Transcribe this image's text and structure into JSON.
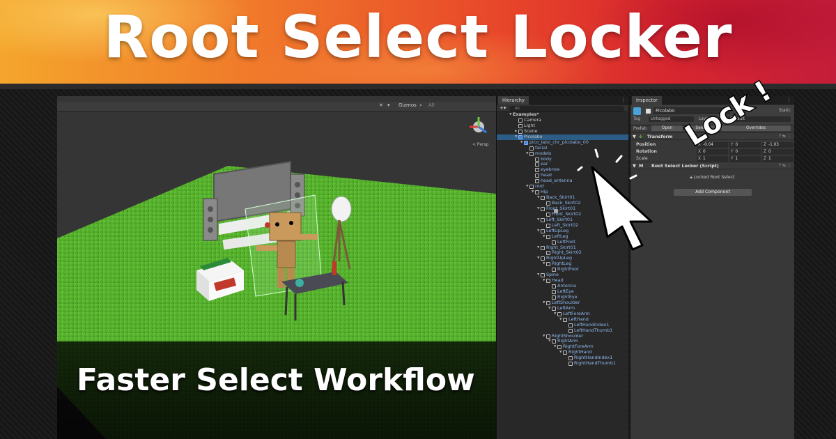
{
  "banner": {
    "title": "Root Select Locker"
  },
  "caption": "Faster Select Workflow",
  "scene_view": {
    "gizmos_label": "Gizmos",
    "search_placeholder": "All",
    "persp_label": "< Persp"
  },
  "hierarchy": {
    "tab_label": "Hierarchy",
    "search_placeholder": "All",
    "rows": [
      {
        "label": "Examples*",
        "depth": 0,
        "arrow": "▼",
        "icon": "scene",
        "style": "bold"
      },
      {
        "label": "Camera",
        "depth": 1,
        "arrow": "",
        "icon": "obj",
        "style": ""
      },
      {
        "label": "Light",
        "depth": 1,
        "arrow": "",
        "icon": "obj",
        "style": ""
      },
      {
        "label": "Scene",
        "depth": 1,
        "arrow": "▶",
        "icon": "obj",
        "style": ""
      },
      {
        "label": "Picolabo",
        "depth": 1,
        "arrow": "▼",
        "icon": "pref",
        "style": "sel"
      },
      {
        "label": "pico_labo_chr_picolabo_00",
        "depth": 2,
        "arrow": "▼",
        "icon": "pref",
        "style": "blue"
      },
      {
        "label": "facial",
        "depth": 3,
        "arrow": "",
        "icon": "obj",
        "style": "blue"
      },
      {
        "label": "models",
        "depth": 3,
        "arrow": "▼",
        "icon": "obj",
        "style": "blue"
      },
      {
        "label": "body",
        "depth": 4,
        "arrow": "",
        "icon": "obj",
        "style": "blue"
      },
      {
        "label": "ear",
        "depth": 4,
        "arrow": "",
        "icon": "obj",
        "style": "blue"
      },
      {
        "label": "eyebrow",
        "depth": 4,
        "arrow": "",
        "icon": "obj",
        "style": "blue"
      },
      {
        "label": "head",
        "depth": 4,
        "arrow": "",
        "icon": "obj",
        "style": "blue"
      },
      {
        "label": "head_antenna",
        "depth": 4,
        "arrow": "",
        "icon": "obj",
        "style": "blue"
      },
      {
        "label": "root",
        "depth": 3,
        "arrow": "▼",
        "icon": "obj",
        "style": "blue"
      },
      {
        "label": "Hip",
        "depth": 4,
        "arrow": "▼",
        "icon": "obj",
        "style": "blue"
      },
      {
        "label": "Back_Skirt01",
        "depth": 5,
        "arrow": "▼",
        "icon": "obj",
        "style": "blue"
      },
      {
        "label": "Back_Skirt02",
        "depth": 6,
        "arrow": "",
        "icon": "obj",
        "style": "blue"
      },
      {
        "label": "Front_Skirt01",
        "depth": 5,
        "arrow": "▼",
        "icon": "obj",
        "style": "blue"
      },
      {
        "label": "Front_Skirt02",
        "depth": 6,
        "arrow": "",
        "icon": "obj",
        "style": "blue"
      },
      {
        "label": "Left_Skirt01",
        "depth": 5,
        "arrow": "▼",
        "icon": "obj",
        "style": "blue"
      },
      {
        "label": "Left_Skirt02",
        "depth": 6,
        "arrow": "",
        "icon": "obj",
        "style": "blue"
      },
      {
        "label": "LeftUpLeg",
        "depth": 5,
        "arrow": "▼",
        "icon": "obj",
        "style": "blue"
      },
      {
        "label": "LeftLeg",
        "depth": 6,
        "arrow": "▼",
        "icon": "obj",
        "style": "blue"
      },
      {
        "label": "LeftFoot",
        "depth": 7,
        "arrow": "",
        "icon": "obj",
        "style": "blue"
      },
      {
        "label": "Right_Skirt01",
        "depth": 5,
        "arrow": "▼",
        "icon": "obj",
        "style": "blue"
      },
      {
        "label": "Right_Skirt02",
        "depth": 6,
        "arrow": "",
        "icon": "obj",
        "style": "blue"
      },
      {
        "label": "RightUpLeg",
        "depth": 5,
        "arrow": "▼",
        "icon": "obj",
        "style": "blue"
      },
      {
        "label": "RightLeg",
        "depth": 6,
        "arrow": "▼",
        "icon": "obj",
        "style": "blue"
      },
      {
        "label": "RightFoot",
        "depth": 7,
        "arrow": "",
        "icon": "obj",
        "style": "blue"
      },
      {
        "label": "Spine",
        "depth": 5,
        "arrow": "▼",
        "icon": "obj",
        "style": "blue"
      },
      {
        "label": "Head",
        "depth": 6,
        "arrow": "▼",
        "icon": "obj",
        "style": "blue"
      },
      {
        "label": "Antenna",
        "depth": 7,
        "arrow": "",
        "icon": "obj",
        "style": "blue"
      },
      {
        "label": "LeftEye",
        "depth": 7,
        "arrow": "",
        "icon": "obj",
        "style": "blue"
      },
      {
        "label": "RightEye",
        "depth": 7,
        "arrow": "",
        "icon": "obj",
        "style": "blue"
      },
      {
        "label": "LeftShoulder",
        "depth": 6,
        "arrow": "▼",
        "icon": "obj",
        "style": "blue"
      },
      {
        "label": "LeftArm",
        "depth": 7,
        "arrow": "▼",
        "icon": "obj",
        "style": "blue"
      },
      {
        "label": "LeftForeArm",
        "depth": 8,
        "arrow": "▼",
        "icon": "obj",
        "style": "blue"
      },
      {
        "label": "LeftHand",
        "depth": 9,
        "arrow": "▼",
        "icon": "obj",
        "style": "blue"
      },
      {
        "label": "LeftHandIndex1",
        "depth": 10,
        "arrow": "",
        "icon": "obj",
        "style": "blue"
      },
      {
        "label": "LeftHandThumb1",
        "depth": 10,
        "arrow": "",
        "icon": "obj",
        "style": "blue"
      },
      {
        "label": "RightShoulder",
        "depth": 6,
        "arrow": "▼",
        "icon": "obj",
        "style": "blue"
      },
      {
        "label": "RightArm",
        "depth": 7,
        "arrow": "▼",
        "icon": "obj",
        "style": "blue"
      },
      {
        "label": "RightForeArm",
        "depth": 8,
        "arrow": "▼",
        "icon": "obj",
        "style": "blue"
      },
      {
        "label": "RightHand",
        "depth": 9,
        "arrow": "▼",
        "icon": "obj",
        "style": "blue"
      },
      {
        "label": "RightHandIndex1",
        "depth": 10,
        "arrow": "",
        "icon": "obj",
        "style": "blue"
      },
      {
        "label": "RightHandThumb1",
        "depth": 10,
        "arrow": "",
        "icon": "obj",
        "style": "blue"
      }
    ]
  },
  "inspector": {
    "tab_label": "Inspector",
    "object_name": "Picolabo",
    "static_label": "Static",
    "tag_prefix": "Tag",
    "tag_value": "Untagged",
    "layer_prefix": "Layer",
    "layer_value": "Default",
    "prefab_label": "Prefab",
    "open_label": "Open",
    "select_label": "Select",
    "overrides_label": "Overrides",
    "transform_title": "Transform",
    "position_label": "Position",
    "rotation_label": "Rotation",
    "scale_label": "Scale",
    "position": {
      "x": "-0.04",
      "y": "0",
      "z": "-1.03"
    },
    "rotation": {
      "x": "0",
      "y": "0",
      "z": "0"
    },
    "scale": {
      "x": "1",
      "y": "1",
      "z": "1"
    },
    "script_title": "Root Select Locker (Script)",
    "locked_label": "Locked Root Select",
    "add_component_label": "Add Component"
  },
  "annotation": {
    "text": "Lock !"
  },
  "colors": {
    "banner_start": "#f4a62c",
    "banner_end": "#c31d3a",
    "selection": "#2c5d87",
    "grass": "#5cb52e"
  }
}
